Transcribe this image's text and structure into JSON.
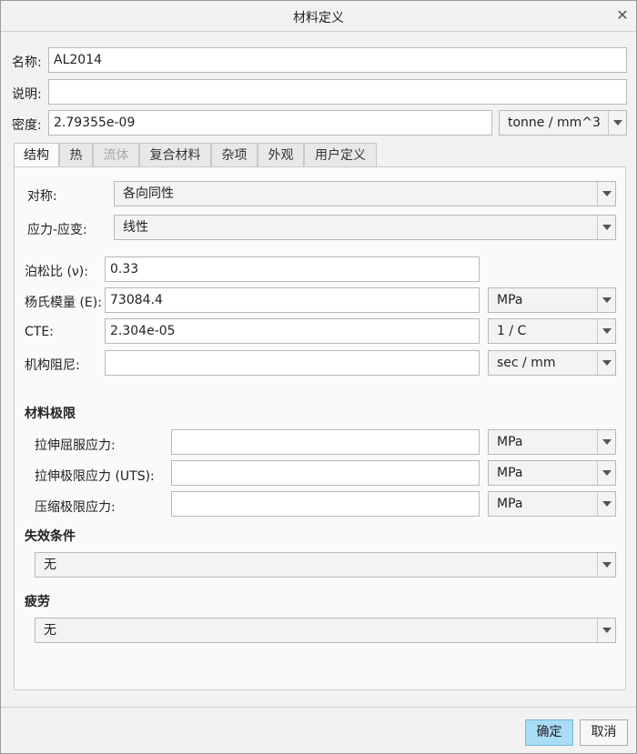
{
  "window": {
    "title": "材料定义",
    "close_glyph": "✕"
  },
  "name": {
    "label": "名称:",
    "value": "AL2014"
  },
  "description": {
    "label": "说明:",
    "value": ""
  },
  "density": {
    "label": "密度:",
    "value": "2.79355e-09",
    "unit": "tonne / mm^3"
  },
  "tabs": [
    {
      "label": "结构",
      "state": "active"
    },
    {
      "label": "热",
      "state": "normal"
    },
    {
      "label": "流体",
      "state": "disabled"
    },
    {
      "label": "复合材料",
      "state": "normal"
    },
    {
      "label": "杂项",
      "state": "normal"
    },
    {
      "label": "外观",
      "state": "normal"
    },
    {
      "label": "用户定义",
      "state": "normal"
    }
  ],
  "structural": {
    "symmetry": {
      "label": "对称:",
      "value": "各向同性"
    },
    "stress_strain": {
      "label": "应力-应变:",
      "value": "线性"
    },
    "poisson": {
      "label": "泊松比 (ν):",
      "value": "0.33"
    },
    "young": {
      "label": "杨氏模量 (E):",
      "value": "73084.4",
      "unit": "MPa"
    },
    "cte": {
      "label": "CTE:",
      "value": "2.304e-05",
      "unit": "1 / C"
    },
    "damping": {
      "label": "机构阻尼:",
      "value": "",
      "unit": "sec / mm"
    }
  },
  "limits": {
    "heading": "材料极限",
    "tensile_yield": {
      "label": "拉伸屈服应力:",
      "value": "",
      "unit": "MPa"
    },
    "tensile_ultimate": {
      "label": "拉伸极限应力 (UTS):",
      "value": "",
      "unit": "MPa"
    },
    "compressive_ultimate": {
      "label": "压缩极限应力:",
      "value": "",
      "unit": "MPa"
    }
  },
  "failure": {
    "heading": "失效条件",
    "value": "无"
  },
  "fatigue": {
    "heading": "疲劳",
    "value": "无"
  },
  "buttons": {
    "ok": "确定",
    "cancel": "取消"
  },
  "colors": {
    "primary_button": "#a9dcf5",
    "panel_bg": "#fafafa",
    "dialog_bg": "#f2f2f2"
  }
}
